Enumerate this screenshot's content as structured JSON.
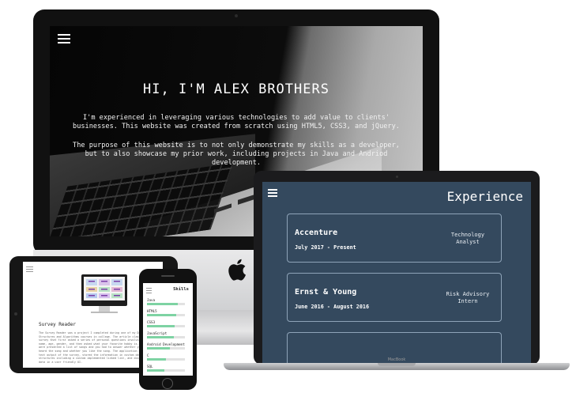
{
  "imac": {
    "hero_title": "HI, I'M ALEX BROTHERS",
    "hero_paragraph_1": "I'm experienced in leveraging various technologies to add value to clients' businesses. This website was created from scratch using HTML5, CSS3, and jQuery.",
    "hero_paragraph_2": "The purpose of this website is to not only demonstrate my skills as a developer, but to also showcase my prior work, including projects in Java and Andriod development."
  },
  "macbook": {
    "section_title": "Experience",
    "brand_label": "MacBook",
    "experiences": [
      {
        "company": "Accenture",
        "dates": "July 2017 - Present",
        "role_line1": "Technology",
        "role_line2": "Analyst"
      },
      {
        "company": "Ernst & Young",
        "dates": "June 2016 - August 2016",
        "role_line1": "Risk Advisory",
        "role_line2": "Intern"
      }
    ]
  },
  "ipad": {
    "project_title": "Survey Reader",
    "project_description": "The Survey Reader was a project I completed during one of my Data Structures and Algorithms courses in college. The article class took a survey that first asked a series of personal questions involving your name, age, gender, and then asked what your favorite hobby is. Next, you were presented a list of songs and you had to answer whether you have heard the song and whether you like the song. The application parsed the text output of the survey, stored the information in custom data structures including a custom implemented linked list, and displayed the data in a user friendly UI."
  },
  "iphone": {
    "section_title": "Skills",
    "skills": [
      {
        "name": "Java",
        "level": 0.82
      },
      {
        "name": "HTML5",
        "level": 0.78
      },
      {
        "name": "CSS3",
        "level": 0.72
      },
      {
        "name": "JavaScript",
        "level": 0.7
      },
      {
        "name": "Android Development",
        "level": 0.6
      },
      {
        "name": "C",
        "level": 0.5
      },
      {
        "name": "SQL",
        "level": 0.45
      }
    ]
  },
  "colors": {
    "experience_bg": "#34495e",
    "skill_bar_fill": "#7ed3a3"
  }
}
